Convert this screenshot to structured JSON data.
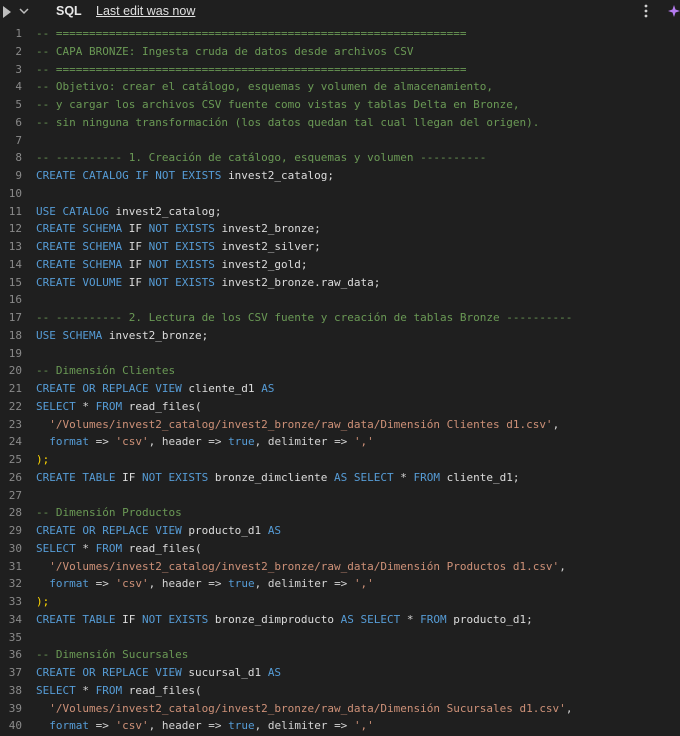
{
  "header": {
    "language_label": "SQL",
    "last_edit": "Last edit was now"
  },
  "icons": {
    "run": "run-icon",
    "collapse": "chevron-down-icon",
    "more": "kebab-icon",
    "assistant": "assistant-icon"
  },
  "colors": {
    "background": "#1f1f1f",
    "comment": "#6a9955",
    "keyword": "#569cd6",
    "string": "#ce9178",
    "line_number": "#8a8a8a"
  },
  "lines": [
    {
      "n": "1",
      "tokens": [
        {
          "c": "cmt",
          "t": "-- =============================================================="
        }
      ]
    },
    {
      "n": "2",
      "tokens": [
        {
          "c": "cmt",
          "t": "-- CAPA BRONZE: Ingesta cruda de datos desde archivos CSV"
        }
      ]
    },
    {
      "n": "3",
      "tokens": [
        {
          "c": "cmt",
          "t": "-- =============================================================="
        }
      ]
    },
    {
      "n": "4",
      "tokens": [
        {
          "c": "cmt",
          "t": "-- Objetivo: crear el catálogo, esquemas y volumen de almacenamiento,"
        }
      ]
    },
    {
      "n": "5",
      "tokens": [
        {
          "c": "cmt",
          "t": "-- y cargar los archivos CSV fuente como vistas y tablas Delta en Bronze,"
        }
      ]
    },
    {
      "n": "6",
      "tokens": [
        {
          "c": "cmt",
          "t": "-- sin ninguna transformación (los datos quedan tal cual llegan del origen)."
        }
      ]
    },
    {
      "n": "7",
      "tokens": []
    },
    {
      "n": "8",
      "tokens": [
        {
          "c": "cmt",
          "t": "-- ---------- 1. Creación de catálogo, esquemas y volumen ----------"
        }
      ]
    },
    {
      "n": "9",
      "tokens": [
        {
          "c": "kw",
          "t": "CREATE CATALOG IF NOT EXISTS "
        },
        {
          "c": "id",
          "t": "invest2_catalog;"
        }
      ]
    },
    {
      "n": "10",
      "tokens": []
    },
    {
      "n": "11",
      "tokens": [
        {
          "c": "kw",
          "t": "USE CATALOG "
        },
        {
          "c": "id",
          "t": "invest2_catalog;"
        }
      ]
    },
    {
      "n": "12",
      "tokens": [
        {
          "c": "kw",
          "t": "CREATE SCHEMA "
        },
        {
          "c": "id",
          "t": "IF "
        },
        {
          "c": "kw",
          "t": "NOT EXISTS "
        },
        {
          "c": "id",
          "t": "invest2_bronze;"
        }
      ]
    },
    {
      "n": "13",
      "tokens": [
        {
          "c": "kw",
          "t": "CREATE SCHEMA "
        },
        {
          "c": "id",
          "t": "IF "
        },
        {
          "c": "kw",
          "t": "NOT EXISTS "
        },
        {
          "c": "id",
          "t": "invest2_silver;"
        }
      ]
    },
    {
      "n": "14",
      "tokens": [
        {
          "c": "kw",
          "t": "CREATE SCHEMA "
        },
        {
          "c": "id",
          "t": "IF "
        },
        {
          "c": "kw",
          "t": "NOT EXISTS "
        },
        {
          "c": "id",
          "t": "invest2_gold;"
        }
      ]
    },
    {
      "n": "15",
      "tokens": [
        {
          "c": "kw",
          "t": "CREATE VOLUME "
        },
        {
          "c": "id",
          "t": "IF "
        },
        {
          "c": "kw",
          "t": "NOT EXISTS "
        },
        {
          "c": "id",
          "t": "invest2_bronze.raw_data;"
        }
      ]
    },
    {
      "n": "16",
      "tokens": []
    },
    {
      "n": "17",
      "tokens": [
        {
          "c": "cmt",
          "t": "-- ---------- 2. Lectura de los CSV fuente y creación de tablas Bronze ----------"
        }
      ]
    },
    {
      "n": "18",
      "tokens": [
        {
          "c": "kw",
          "t": "USE SCHEMA "
        },
        {
          "c": "id",
          "t": "invest2_bronze;"
        }
      ]
    },
    {
      "n": "19",
      "tokens": []
    },
    {
      "n": "20",
      "tokens": [
        {
          "c": "cmt",
          "t": "-- Dimensión Clientes"
        }
      ]
    },
    {
      "n": "21",
      "tokens": [
        {
          "c": "kw",
          "t": "CREATE OR REPLACE VIEW "
        },
        {
          "c": "id",
          "t": "cliente_d1 "
        },
        {
          "c": "kw",
          "t": "AS"
        }
      ]
    },
    {
      "n": "22",
      "tokens": [
        {
          "c": "kw",
          "t": "SELECT "
        },
        {
          "c": "op",
          "t": "* "
        },
        {
          "c": "kw",
          "t": "FROM "
        },
        {
          "c": "id",
          "t": "read_files("
        }
      ]
    },
    {
      "n": "23",
      "tokens": [
        {
          "c": "str",
          "t": "  '/Volumes/invest2_catalog/invest2_bronze/raw_data/Dimensión Clientes d1.csv'"
        },
        {
          "c": "op",
          "t": ","
        }
      ]
    },
    {
      "n": "24",
      "tokens": [
        {
          "c": "kw",
          "t": "  format "
        },
        {
          "c": "op",
          "t": "=> "
        },
        {
          "c": "str",
          "t": "'csv'"
        },
        {
          "c": "op",
          "t": ", header => "
        },
        {
          "c": "kw",
          "t": "true"
        },
        {
          "c": "op",
          "t": ", delimiter => "
        },
        {
          "c": "str",
          "t": "','"
        }
      ]
    },
    {
      "n": "25",
      "tokens": [
        {
          "c": "pun",
          "t": ");"
        }
      ]
    },
    {
      "n": "26",
      "tokens": [
        {
          "c": "kw",
          "t": "CREATE TABLE "
        },
        {
          "c": "id",
          "t": "IF "
        },
        {
          "c": "kw",
          "t": "NOT EXISTS "
        },
        {
          "c": "id",
          "t": "bronze_dimcliente "
        },
        {
          "c": "kw",
          "t": "AS SELECT "
        },
        {
          "c": "op",
          "t": "* "
        },
        {
          "c": "kw",
          "t": "FROM "
        },
        {
          "c": "id",
          "t": "cliente_d1;"
        }
      ]
    },
    {
      "n": "27",
      "tokens": []
    },
    {
      "n": "28",
      "tokens": [
        {
          "c": "cmt",
          "t": "-- Dimensión Productos"
        }
      ]
    },
    {
      "n": "29",
      "tokens": [
        {
          "c": "kw",
          "t": "CREATE OR REPLACE VIEW "
        },
        {
          "c": "id",
          "t": "producto_d1 "
        },
        {
          "c": "kw",
          "t": "AS"
        }
      ]
    },
    {
      "n": "30",
      "tokens": [
        {
          "c": "kw",
          "t": "SELECT "
        },
        {
          "c": "op",
          "t": "* "
        },
        {
          "c": "kw",
          "t": "FROM "
        },
        {
          "c": "id",
          "t": "read_files("
        }
      ]
    },
    {
      "n": "31",
      "tokens": [
        {
          "c": "str",
          "t": "  '/Volumes/invest2_catalog/invest2_bronze/raw_data/Dimensión Productos d1.csv'"
        },
        {
          "c": "op",
          "t": ","
        }
      ]
    },
    {
      "n": "32",
      "tokens": [
        {
          "c": "kw",
          "t": "  format "
        },
        {
          "c": "op",
          "t": "=> "
        },
        {
          "c": "str",
          "t": "'csv'"
        },
        {
          "c": "op",
          "t": ", header => "
        },
        {
          "c": "kw",
          "t": "true"
        },
        {
          "c": "op",
          "t": ", delimiter => "
        },
        {
          "c": "str",
          "t": "','"
        }
      ]
    },
    {
      "n": "33",
      "tokens": [
        {
          "c": "pun",
          "t": ");"
        }
      ]
    },
    {
      "n": "34",
      "tokens": [
        {
          "c": "kw",
          "t": "CREATE TABLE "
        },
        {
          "c": "id",
          "t": "IF "
        },
        {
          "c": "kw",
          "t": "NOT EXISTS "
        },
        {
          "c": "id",
          "t": "bronze_dimproducto "
        },
        {
          "c": "kw",
          "t": "AS SELECT "
        },
        {
          "c": "op",
          "t": "* "
        },
        {
          "c": "kw",
          "t": "FROM "
        },
        {
          "c": "id",
          "t": "producto_d1;"
        }
      ]
    },
    {
      "n": "35",
      "tokens": []
    },
    {
      "n": "36",
      "tokens": [
        {
          "c": "cmt",
          "t": "-- Dimensión Sucursales"
        }
      ]
    },
    {
      "n": "37",
      "tokens": [
        {
          "c": "kw",
          "t": "CREATE OR REPLACE VIEW "
        },
        {
          "c": "id",
          "t": "sucursal_d1 "
        },
        {
          "c": "kw",
          "t": "AS"
        }
      ]
    },
    {
      "n": "38",
      "tokens": [
        {
          "c": "kw",
          "t": "SELECT "
        },
        {
          "c": "op",
          "t": "* "
        },
        {
          "c": "kw",
          "t": "FROM "
        },
        {
          "c": "id",
          "t": "read_files("
        }
      ]
    },
    {
      "n": "39",
      "tokens": [
        {
          "c": "str",
          "t": "  '/Volumes/invest2_catalog/invest2_bronze/raw_data/Dimensión Sucursales d1.csv'"
        },
        {
          "c": "op",
          "t": ","
        }
      ]
    },
    {
      "n": "40",
      "tokens": [
        {
          "c": "kw",
          "t": "  format "
        },
        {
          "c": "op",
          "t": "=> "
        },
        {
          "c": "str",
          "t": "'csv'"
        },
        {
          "c": "op",
          "t": ", header => "
        },
        {
          "c": "kw",
          "t": "true"
        },
        {
          "c": "op",
          "t": ", delimiter => "
        },
        {
          "c": "str",
          "t": "','"
        }
      ]
    }
  ]
}
